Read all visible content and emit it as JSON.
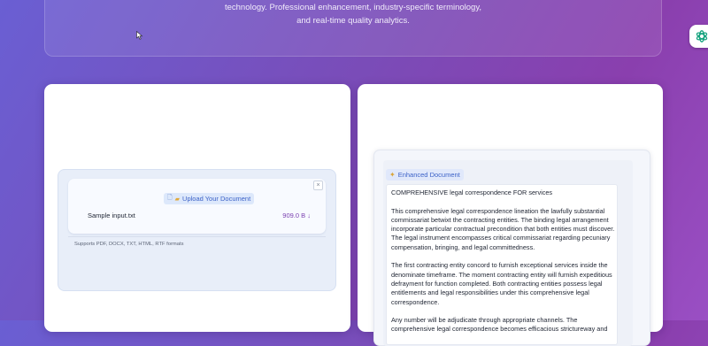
{
  "hero": {
    "line1": "technology. Professional enhancement, industry-specific terminology,",
    "line2": "and real-time quality analytics."
  },
  "side_button": {
    "icon": "chatgpt-icon"
  },
  "upload": {
    "button_label": "Upload Your Document",
    "button_icons": [
      "document-icon",
      "folder-icon"
    ],
    "close_label": "×",
    "file_name": "Sample input.txt",
    "file_size": "909.0 B",
    "file_size_arrow": "↓",
    "formats_note": "Supports PDF, DOCX, TXT, HTML, RTF formats"
  },
  "document": {
    "badge_icon": "sparkle-icon",
    "badge_label": "Enhanced Document",
    "title": "COMPREHENSIVE legal correspondence FOR services",
    "para1": [
      "This comprehensive legal correspondence lineation the lawfully substantial",
      "commissariat betwixt the contracting entities. The binding legal arrangement",
      "incorporate particular contractual precondition that both entities must discover.",
      "The legal instrument encompasses critical commissariat regarding pecuniary",
      "compensation, bringing, and legal committedness."
    ],
    "para2": [
      "The first contracting entity concord to furnish exceptional services inside the",
      "denominate timeframe. The moment contracting entity will furnish expeditious",
      "defrayment for function completed. Both contracting entities possess legal",
      "entitlements and legal responsibilities under this comprehensive legal",
      "correspondence."
    ],
    "para3": [
      "Any number will be adjudicate through appropriate channels. The",
      "comprehensive legal correspondence becomes efficacious strictureway and"
    ]
  }
}
